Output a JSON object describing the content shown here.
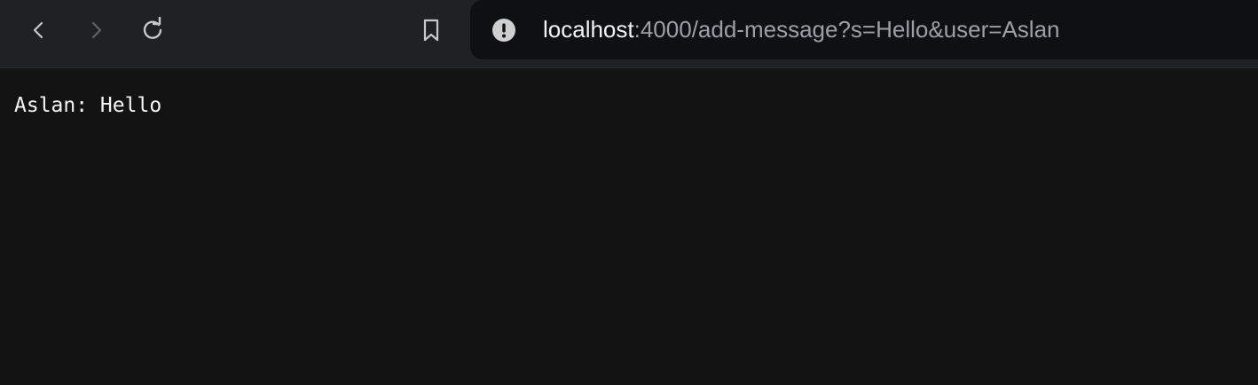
{
  "browser": {
    "icons": {
      "back": "chevron-left-icon",
      "forward": "chevron-right-icon",
      "reload": "reload-icon",
      "bookmark": "bookmark-icon",
      "site_info": "info-warning-icon"
    },
    "address_bar": {
      "host": "localhost",
      "rest": ":4000/add-message?s=Hello&user=Aslan"
    },
    "colors": {
      "toolbar_bg": "#202124",
      "omnibox_bg": "#0f1014",
      "page_bg": "#131313",
      "text_primary": "#f2f2f2",
      "text_secondary": "#9aa0a6"
    }
  },
  "page": {
    "message": "Aslan: Hello"
  }
}
